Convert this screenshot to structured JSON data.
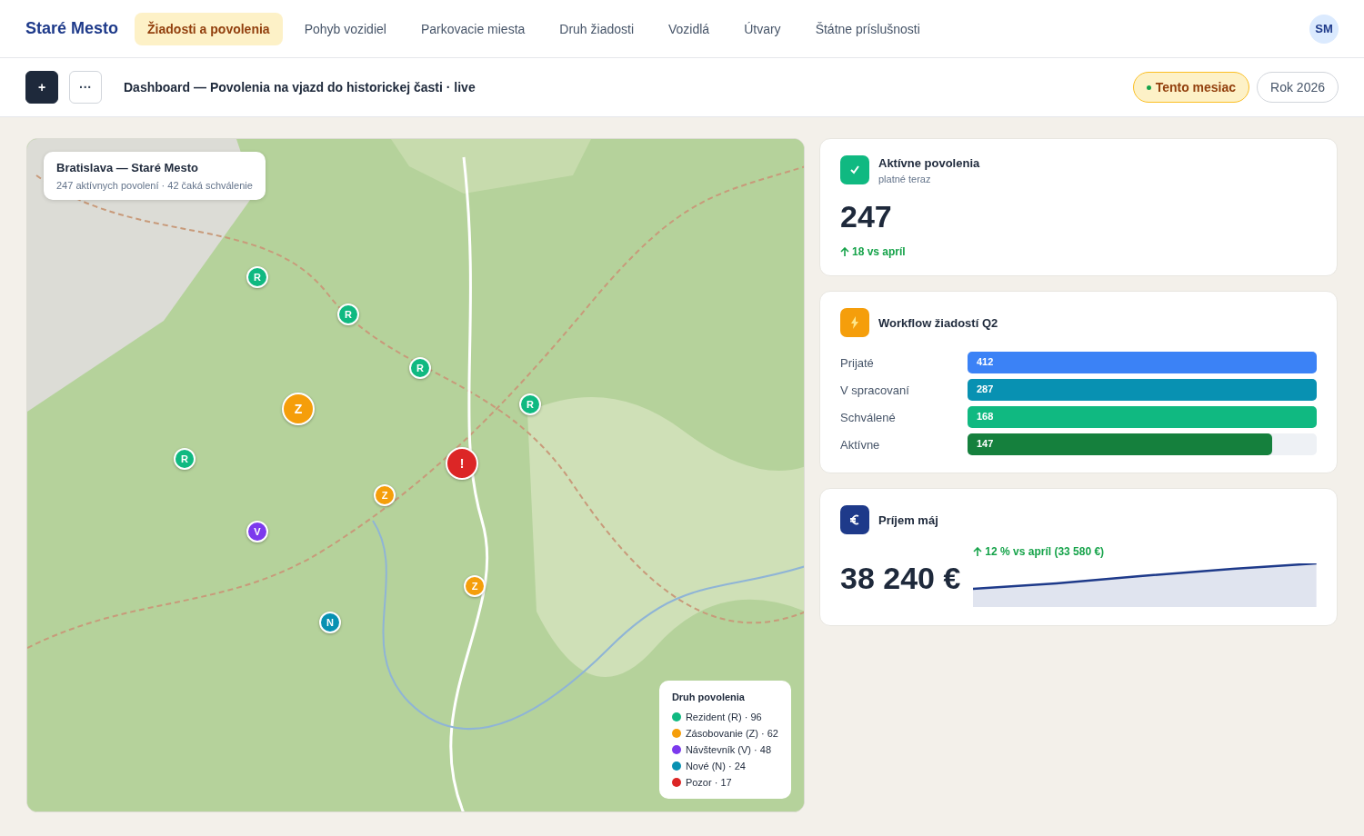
{
  "brand": "Staré Mesto",
  "nav": [
    {
      "label": "Žiadosti a povolenia",
      "selected": true
    },
    {
      "label": "Pohyb vozidiel",
      "selected": false
    },
    {
      "label": "Parkovacie miesta",
      "selected": false
    },
    {
      "label": "Druh žiadosti",
      "selected": false
    },
    {
      "label": "Vozidlá",
      "selected": false
    },
    {
      "label": "Útvary",
      "selected": false
    },
    {
      "label": "Štátne príslušnosti",
      "selected": false
    }
  ],
  "avatar": "SM",
  "toolbar": {
    "add": "+",
    "more": "···",
    "title": "Dashboard — Povolenia na vjazd do historickej časti · live",
    "periods": [
      {
        "label": "Tento mesiac",
        "selected": true
      },
      {
        "label": "Rok 2026",
        "selected": false
      }
    ]
  },
  "map": {
    "title": "Bratislava — Staré Mesto",
    "subtitle": "247 aktívnych povolení · 42 čaká schválenie",
    "pins": [
      {
        "label": "R",
        "color": "#10b981",
        "large": false
      },
      {
        "label": "R",
        "color": "#10b981",
        "large": false
      },
      {
        "label": "R",
        "color": "#10b981",
        "large": false
      },
      {
        "label": "Z",
        "color": "#f59e0b",
        "large": true
      },
      {
        "label": "R",
        "color": "#10b981",
        "large": false
      },
      {
        "label": "R",
        "color": "#10b981",
        "large": false
      },
      {
        "label": "!",
        "color": "#dc2626",
        "large": true
      },
      {
        "label": "Z",
        "color": "#f59e0b",
        "large": false
      },
      {
        "label": "V",
        "color": "#7c3aed",
        "large": false
      },
      {
        "label": "Z",
        "color": "#f59e0b",
        "large": false
      },
      {
        "label": "N",
        "color": "#0891b2",
        "large": false
      }
    ],
    "legend": {
      "title": "Druh povolenia",
      "items": [
        {
          "label": "Rezident (R) · 96",
          "color": "#10b981"
        },
        {
          "label": "Zásobovanie (Z) · 62",
          "color": "#f59e0b"
        },
        {
          "label": "Návštevník (V) · 48",
          "color": "#7c3aed"
        },
        {
          "label": "Nové (N) · 24",
          "color": "#0891b2"
        },
        {
          "label": "Pozor · 17",
          "color": "#dc2626"
        }
      ]
    }
  },
  "cards": [
    {
      "kind": "stat",
      "title": "Aktívne povolenia",
      "subtitle": "platné teraz",
      "value": "247",
      "delta": "18 vs apríl"
    },
    {
      "kind": "bars",
      "title": "Workflow žiadostí Q2",
      "rows": [
        {
          "label": "Prijaté",
          "value": "412",
          "level": 1,
          "color": "#3b82f6"
        },
        {
          "label": "V spracovaní",
          "value": "287",
          "level": 1,
          "color": "#0891b2"
        },
        {
          "label": "Schválené",
          "value": "168",
          "level": 1,
          "color": "#10b981"
        },
        {
          "label": "Aktívne",
          "value": "147",
          "level": 0.873,
          "color": "#15803d"
        }
      ]
    },
    {
      "kind": "revenue",
      "title": "Príjem máj",
      "value": "38 240 €",
      "delta": "12 % vs apríl (33 580 €)"
    }
  ]
}
